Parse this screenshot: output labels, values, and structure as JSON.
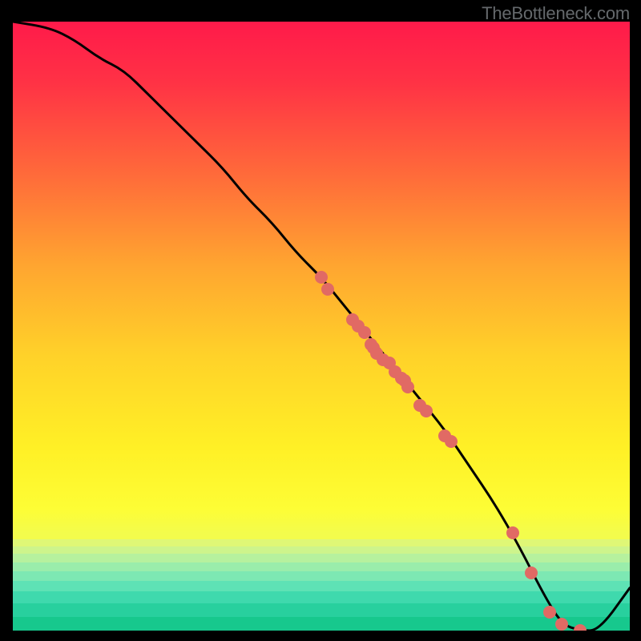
{
  "watermark": "TheBottleneck.com",
  "chart_data": {
    "type": "line",
    "title": "",
    "xlabel": "",
    "ylabel": "",
    "xlim": [
      0,
      100
    ],
    "ylim": [
      0,
      100
    ],
    "grid": false,
    "legend": false,
    "series": [
      {
        "name": "bottleneck-curve",
        "x": [
          0,
          6,
          10,
          14,
          18,
          22,
          26,
          30,
          34,
          38,
          42,
          46,
          50,
          54,
          58,
          62,
          66,
          70,
          74,
          78,
          82,
          86,
          89,
          92,
          95,
          100
        ],
        "y": [
          100,
          99,
          97,
          94,
          92,
          88,
          84,
          80,
          76,
          71,
          67,
          62,
          58,
          53,
          48,
          43,
          38,
          33,
          27,
          21,
          14,
          6,
          1,
          0,
          0,
          7
        ]
      }
    ],
    "scatter": {
      "name": "sample-points",
      "points": [
        {
          "x": 50,
          "y": 58
        },
        {
          "x": 51,
          "y": 56
        },
        {
          "x": 55,
          "y": 51
        },
        {
          "x": 56,
          "y": 50
        },
        {
          "x": 57,
          "y": 49
        },
        {
          "x": 58,
          "y": 47
        },
        {
          "x": 58.5,
          "y": 46.5
        },
        {
          "x": 59,
          "y": 45.5
        },
        {
          "x": 60,
          "y": 44.5
        },
        {
          "x": 61,
          "y": 44
        },
        {
          "x": 62,
          "y": 42.5
        },
        {
          "x": 63,
          "y": 41.5
        },
        {
          "x": 63.5,
          "y": 41
        },
        {
          "x": 64,
          "y": 40
        },
        {
          "x": 66,
          "y": 37
        },
        {
          "x": 67,
          "y": 36
        },
        {
          "x": 70,
          "y": 32
        },
        {
          "x": 71,
          "y": 31
        },
        {
          "x": 81,
          "y": 16
        },
        {
          "x": 84,
          "y": 9.5
        },
        {
          "x": 87,
          "y": 3
        },
        {
          "x": 89,
          "y": 1
        },
        {
          "x": 92,
          "y": 0
        }
      ]
    },
    "gradient_stops": [
      {
        "pos": 0.0,
        "color": "#ff1a4a"
      },
      {
        "pos": 0.1,
        "color": "#ff3245"
      },
      {
        "pos": 0.25,
        "color": "#ff6a3a"
      },
      {
        "pos": 0.4,
        "color": "#ffa530"
      },
      {
        "pos": 0.55,
        "color": "#ffd229"
      },
      {
        "pos": 0.7,
        "color": "#fff026"
      },
      {
        "pos": 0.8,
        "color": "#fdfd35"
      },
      {
        "pos": 0.84,
        "color": "#f3fc4c"
      }
    ],
    "green_bands": [
      {
        "top": 0.85,
        "bottom": 0.862,
        "color": "#dff776"
      },
      {
        "top": 0.862,
        "bottom": 0.874,
        "color": "#cdf48c"
      },
      {
        "top": 0.874,
        "bottom": 0.888,
        "color": "#b6f19e"
      },
      {
        "top": 0.888,
        "bottom": 0.902,
        "color": "#9aedab"
      },
      {
        "top": 0.902,
        "bottom": 0.918,
        "color": "#7de8b3"
      },
      {
        "top": 0.918,
        "bottom": 0.935,
        "color": "#5ee2b5"
      },
      {
        "top": 0.935,
        "bottom": 0.955,
        "color": "#3fd9ad"
      },
      {
        "top": 0.955,
        "bottom": 0.978,
        "color": "#28d09e"
      },
      {
        "top": 0.978,
        "bottom": 1.0,
        "color": "#17c88d"
      }
    ]
  }
}
